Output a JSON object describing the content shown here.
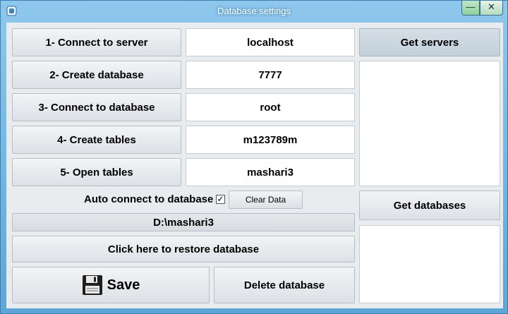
{
  "window": {
    "title": "Database settings",
    "minimize_label": "—",
    "close_label": "✕"
  },
  "steps": [
    {
      "label": "1- Connect to server",
      "value": "localhost"
    },
    {
      "label": "2- Create database",
      "value": "7777"
    },
    {
      "label": "3- Connect to database",
      "value": "root"
    },
    {
      "label": "4- Create tables",
      "value": "m123789m"
    },
    {
      "label": "5- Open tables",
      "value": "mashari3"
    }
  ],
  "auto_connect": {
    "label": "Auto connect to database",
    "checked": true,
    "check_glyph": "✓"
  },
  "clear_data_label": "Clear Data",
  "path_value": "D:\\mashari3",
  "restore_label": "Click here to restore database",
  "save_label": "Save",
  "delete_label": "Delete database",
  "servers": {
    "button_label": "Get servers",
    "items": []
  },
  "databases": {
    "button_label": "Get databases",
    "items": []
  },
  "colors": {
    "title_bar": "#6fb3e0",
    "client_bg": "#e9ecef",
    "accent_button": "#c8d4de"
  }
}
